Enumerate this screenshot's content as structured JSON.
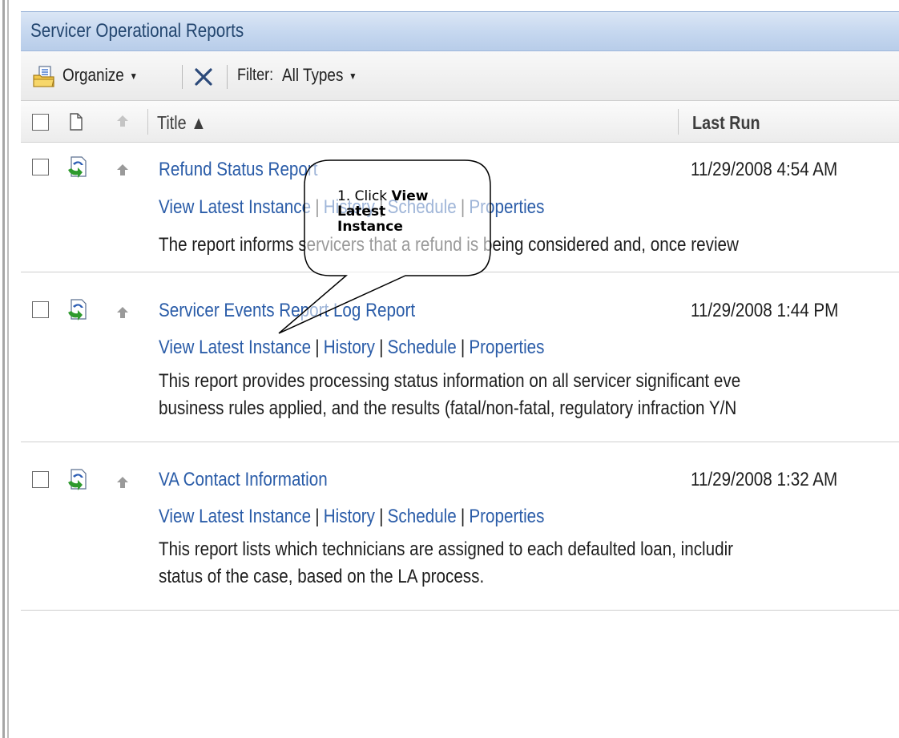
{
  "panel": {
    "title": "Servicer Operational Reports"
  },
  "toolbar": {
    "organize_icon": "folder-document-icon",
    "organize_label": "Organize",
    "delete_icon": "delete-x-icon",
    "filter_label": "Filter:",
    "filter_value": "All Types"
  },
  "columns": {
    "icon_col": "document-icon",
    "priority_col": "up-arrow-icon",
    "title": "Title ▲",
    "last_run": "Last Run"
  },
  "links": {
    "view_latest": "View Latest Instance",
    "history": "History",
    "schedule": "Schedule",
    "properties": "Properties",
    "separator": "|"
  },
  "reports": [
    {
      "title": "Refund Status Report",
      "last_run": "11/29/2008 4:54 AM",
      "desc_1": "The report informs servicers that a refund is being considered and, once review",
      "desc_2": ""
    },
    {
      "title": "Servicer Events Report Log Report",
      "last_run": "11/29/2008 1:44 PM",
      "desc_1": "This report provides processing status information on all servicer significant eve",
      "desc_2": "business rules applied, and the results (fatal/non-fatal, regulatory infraction Y/N"
    },
    {
      "title": "VA Contact Information",
      "last_run": "11/29/2008 1:32 AM",
      "desc_1": "This report lists which technicians are assigned to each defaulted loan, includir",
      "desc_2": "status of the case, based on the LA process."
    }
  ],
  "callout": {
    "prefix": "1. Click ",
    "bold_1": "View",
    "bold_2": "Latest",
    "bold_3": "Instance"
  },
  "colors": {
    "link": "#2a5ca8",
    "title_bar": "#c5d7ef",
    "title_text": "#23466f",
    "icon_green": "#2e9a2e",
    "icon_blue": "#2f5fb5"
  }
}
